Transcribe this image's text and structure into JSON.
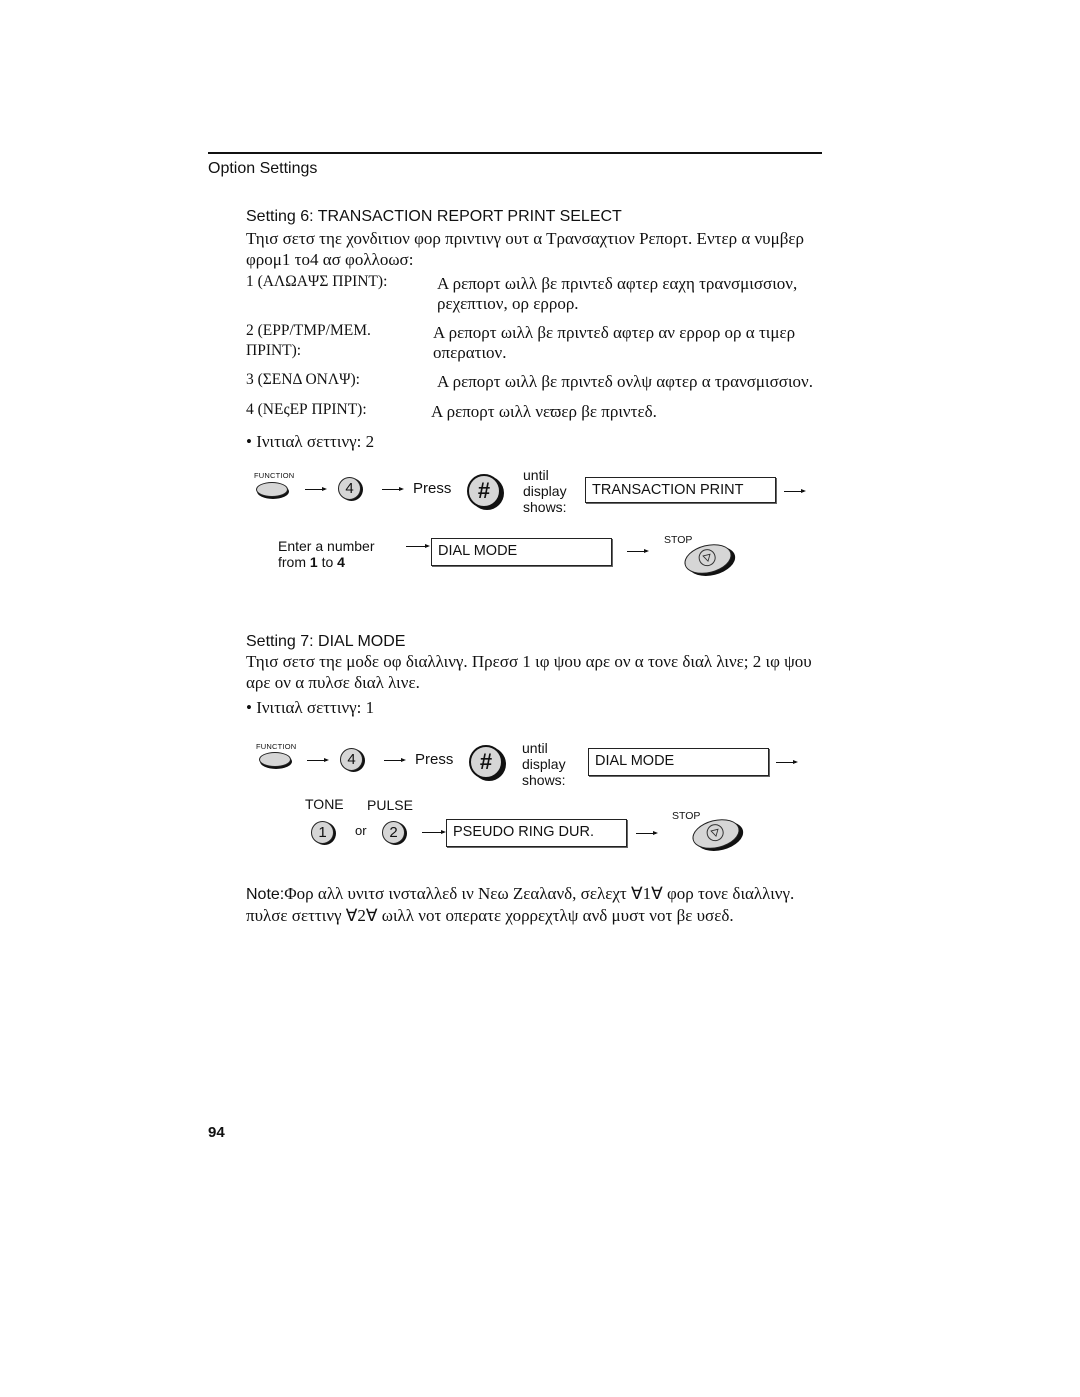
{
  "page": {
    "section_header": "Option Settings",
    "page_number": "94"
  },
  "setting6": {
    "title": "Setting 6: TRANSACTION REPORT PRINT SELECT",
    "intro_line1": "Τηισ σετσ τηε χονδιτιον φορ πριντινγ ουτ α Τρανσαχτιον Ρεπορτ. Εντερ α νυμβερ",
    "intro_line2": "φρομ1 το4 ασ φολλοωσ:",
    "options": [
      {
        "label_line1": "1 (ΑΛΩΑΨΣ ΠΡΙΝΤ):",
        "label_line2": "",
        "desc_line1": "Α ρεπορτ ωιλλ βε πριντεδ αφτερ εαχη τρανσμισσιον,",
        "desc_line2": "ρεχεπτιον, ορ ερρορ."
      },
      {
        "label_line1": "2 (ΕΡΡ/ΤΜΡ/ΜΕΜ.",
        "label_line2": "ΠΡΙΝΤ):",
        "desc_line1": "Α ρεπορτ ωιλλ βε πριντεδ αφτερ αν ερρορ ορ α τιμερ",
        "desc_line2": "οπερατιον."
      },
      {
        "label_line1": "3 (ΣΕΝΔ ΟΝΛΨ):",
        "label_line2": "",
        "desc_line1": "Α ρεπορτ ωιλλ βε πριντεδ ονλψ αφτερ α τρανσμισσιον.",
        "desc_line2": ""
      },
      {
        "label_line1": "4 (ΝΕςΕΡ ΠΡΙΝΤ):",
        "label_line2": "",
        "desc_line1": "Α ρεπορτ ωιλλ νεϖερ βε πριντεδ.",
        "desc_line2": ""
      }
    ],
    "initial_setting": "• Ινιτιαλ σεττινγ: 2",
    "diagram": {
      "function_label": "FUNCTION",
      "key_number": "4",
      "press_label": "Press",
      "hash_glyph": "#",
      "until_lines": [
        "until",
        "display",
        "shows:"
      ],
      "display_1": "TRANSACTION PRINT",
      "enter_line1": "Enter a number",
      "enter_line2_prefix": "from ",
      "enter_from": "1",
      "enter_to_word": " to ",
      "enter_to": "4",
      "display_2": "DIAL MODE",
      "stop_label": "STOP"
    }
  },
  "setting7": {
    "title": "Setting 7: DIAL MODE",
    "intro_line1": "Τηισ σετσ τηε μοδε οφ διαλλινγ. Πρεσσ 1 ιφ ψου αρε ον α τονε διαλ λινε; 2 ιφ ψου",
    "intro_line2": "αρε ον α πυλσε διαλ λινε.",
    "initial_setting": "• Ινιτιαλ σεττινγ: 1",
    "diagram": {
      "function_label": "FUNCTION",
      "key_number": "4",
      "press_label": "Press",
      "hash_glyph": "#",
      "until_lines": [
        "until",
        "display",
        "shows:"
      ],
      "display_1": "DIAL MODE",
      "tone_label": "TONE",
      "pulse_label": "PULSE",
      "key_tone": "1",
      "or_label": "or",
      "key_pulse": "2",
      "display_2": "PSEUDO RING DUR.",
      "stop_label": "STOP"
    }
  },
  "note": {
    "prefix": "Note:",
    "line1": "Φορ αλλ υνιτσ ινσταλλεδ ιν Νεω Ζεαλανδ, σελεχτ ∀1∀ φορ τονε διαλλινγ.",
    "line2": "πυλσε σεττινγ ∀2∀ ωιλλ νοτ οπερατε χορρεχτλψ ανδ μυστ νοτ βε υσεδ."
  }
}
